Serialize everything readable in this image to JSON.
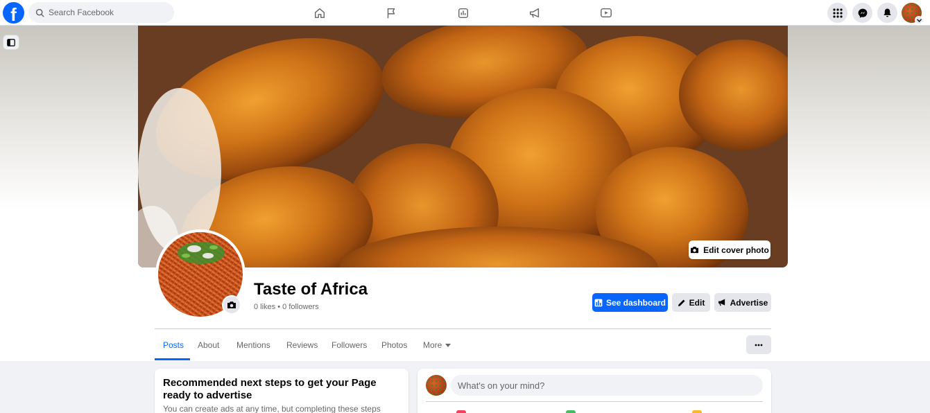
{
  "topbar": {
    "logo_letter": "f",
    "search_placeholder": "Search Facebook",
    "nav_tabs": [
      "home-icon",
      "flag-icon",
      "insights-icon",
      "megaphone-icon",
      "video-icon"
    ],
    "right_buttons": [
      "menu-grid-icon",
      "messenger-icon",
      "bell-icon"
    ]
  },
  "cover": {
    "edit_label": "Edit cover photo"
  },
  "profile": {
    "name": "Taste of Africa",
    "stats": "0 likes • 0 followers"
  },
  "actions": {
    "dashboard_label": "See dashboard",
    "edit_label": "Edit",
    "advertise_label": "Advertise"
  },
  "tabs": [
    {
      "label": "Posts",
      "active": true
    },
    {
      "label": "About",
      "active": false
    },
    {
      "label": "Mentions",
      "active": false
    },
    {
      "label": "Reviews",
      "active": false
    },
    {
      "label": "Followers",
      "active": false
    },
    {
      "label": "Photos",
      "active": false
    },
    {
      "label": "More",
      "active": false
    }
  ],
  "recommended": {
    "title": "Recommended next steps to get your Page ready to advertise",
    "body": "You can create ads at any time, but completing these steps"
  },
  "composer": {
    "placeholder": "What's on your mind?"
  },
  "colors": {
    "brand": "#0866ff",
    "page_bg": "#f0f2f5",
    "button_gray": "#e4e6eb",
    "text_secondary": "#65676b"
  }
}
